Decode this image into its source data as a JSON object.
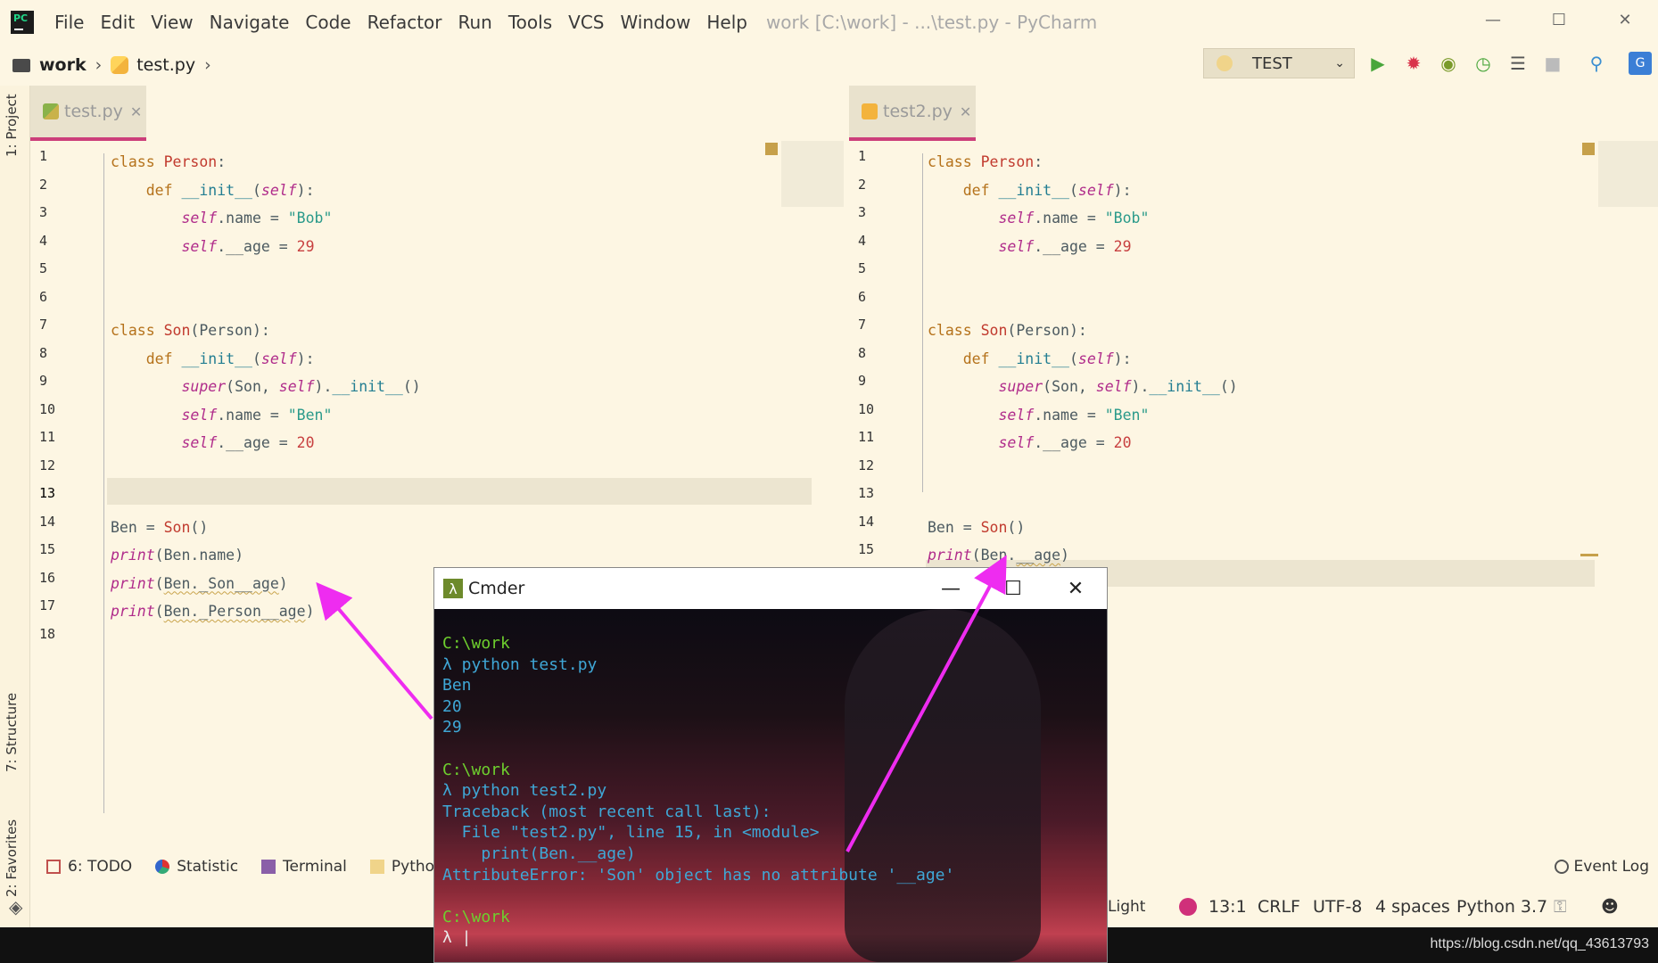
{
  "titlebar": {
    "menu": [
      "File",
      "Edit",
      "View",
      "Navigate",
      "Code",
      "Refactor",
      "Run",
      "Tools",
      "VCS",
      "Window",
      "Help"
    ],
    "window_title": "work [C:\\work] - ...\\test.py - PyCharm"
  },
  "navbar": {
    "project": "work",
    "file": "test.py"
  },
  "run_config": {
    "label": "TEST"
  },
  "left_tabs": {
    "project": "1: Project",
    "structure": "7: Structure",
    "favorites": "2: Favorites"
  },
  "left_editor": {
    "tab": "test.py",
    "current_line": 13,
    "lines": [
      "1",
      "2",
      "3",
      "4",
      "5",
      "6",
      "7",
      "8",
      "9",
      "10",
      "11",
      "12",
      "13",
      "14",
      "15",
      "16",
      "17",
      "18"
    ]
  },
  "right_editor": {
    "tab": "test2.py",
    "lines": [
      "1",
      "2",
      "3",
      "4",
      "5",
      "6",
      "7",
      "8",
      "9",
      "10",
      "11",
      "12",
      "13",
      "14",
      "15"
    ]
  },
  "bottom_tabs": [
    "6: TODO",
    "Statistic",
    "Terminal",
    "Python"
  ],
  "event_log": "Event Log",
  "status": {
    "theme": "Light",
    "position": "13:1",
    "line_sep": "CRLF",
    "encoding": "UTF-8",
    "indent": "4 spaces",
    "interpreter": "Python 3.7"
  },
  "watermark": "https://blog.csdn.net/qq_43613793",
  "cmder": {
    "title": "Cmder",
    "lines": [
      {
        "text": "C:\\work",
        "cls": "g"
      },
      {
        "text": "λ python test.py",
        "cls": "c"
      },
      {
        "text": "Ben",
        "cls": "c"
      },
      {
        "text": "20",
        "cls": "c"
      },
      {
        "text": "29",
        "cls": "c"
      },
      {
        "text": "",
        "cls": "c"
      },
      {
        "text": "C:\\work",
        "cls": "g"
      },
      {
        "text": "λ python test2.py",
        "cls": "c"
      },
      {
        "text": "Traceback (most recent call last):",
        "cls": "c"
      },
      {
        "text": "  File \"test2.py\", line 15, in <module>",
        "cls": "c"
      },
      {
        "text": "    print(Ben.__age)",
        "cls": "c"
      },
      {
        "text": "AttributeError: 'Son' object has no attribute '__age'",
        "cls": "c"
      },
      {
        "text": "",
        "cls": "c"
      },
      {
        "text": "C:\\work",
        "cls": "g"
      },
      {
        "text": "λ |",
        "cls": "w"
      }
    ]
  },
  "colors": {
    "bg": "#fdf6e3",
    "tab_accent": "#cc3e7a",
    "arrow": "#ee2cf0",
    "prompt_green": "#6ecf2e",
    "output_cyan": "#3fa7d6"
  }
}
